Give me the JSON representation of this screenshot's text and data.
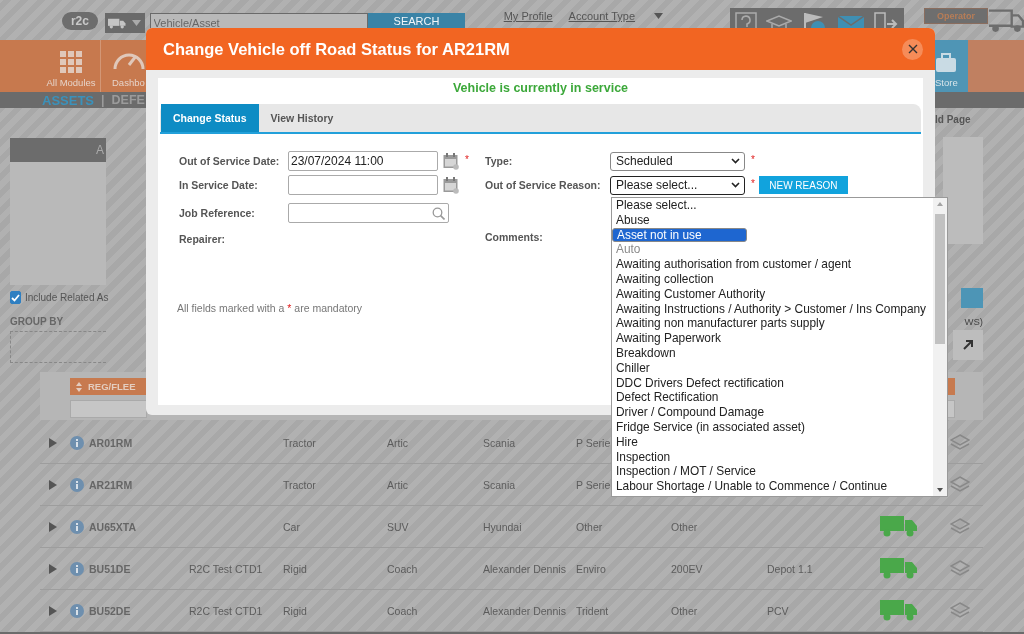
{
  "topbar": {
    "logo": "r2c",
    "search": {
      "placeholder": "Vehicle/Asset"
    },
    "search_button": "SEARCH",
    "links": [
      "My Profile",
      "Account Type"
    ],
    "operator_button": "Operator"
  },
  "nav": {
    "tiles": [
      {
        "label": "All Modules",
        "kind": "grid"
      },
      {
        "label": "Dashbo",
        "kind": "gauge"
      }
    ],
    "store": {
      "label": "Store"
    }
  },
  "breadcrumb": {
    "current": "ASSETS",
    "separator": "|",
    "next": "DEFE"
  },
  "page": {
    "panel_title": "A",
    "page_link": "ld Page",
    "include_related": {
      "label": "Include Related As",
      "checked": true
    },
    "group_by": "GROUP BY",
    "rows_note": "WS)",
    "sort_column": "REG/FLEE"
  },
  "table": {
    "rows": [
      {
        "cells": {
          "column_1": "AR01RM",
          "column_3": "Tractor",
          "column_4": "Artic",
          "column_5": "Scania",
          "column_6": "P Serie"
        },
        "vehicle_icon": false
      },
      {
        "cells": {
          "column_1": "AR21RM",
          "column_3": "Tractor",
          "column_4": "Artic",
          "column_5": "Scania",
          "column_6": "P Serie"
        },
        "vehicle_icon": false
      },
      {
        "cells": {
          "column_1": "AU65XTA",
          "column_3": "Car",
          "column_4": "SUV",
          "column_5": "Hyundai",
          "column_6": "Other",
          "column_7": "Other"
        },
        "vehicle_icon": true
      },
      {
        "cells": {
          "column_1": "BU51DE",
          "column_2": "R2C Test CTD1",
          "column_3": "Rigid",
          "column_4": "Coach",
          "column_5": "Alexander Dennis",
          "column_6": "Enviro",
          "column_7": "200EV",
          "column_8": "Depot 1.1"
        },
        "vehicle_icon": true
      },
      {
        "cells": {
          "column_1": "BU52DE",
          "column_2": "R2C Test CTD1",
          "column_3": "Rigid",
          "column_4": "Coach",
          "column_5": "Alexander Dennis",
          "column_6": "Trident",
          "column_7": "Other",
          "column_8": "PCV"
        },
        "vehicle_icon": true
      }
    ]
  },
  "dialog": {
    "title": "Change Vehicle off Road Status for AR21RM",
    "status_message": "Vehicle is currently in service",
    "tabs": [
      {
        "label": "Change Status",
        "selected": true
      },
      {
        "label": "View History",
        "selected": false
      }
    ],
    "required_mark": "*",
    "left_fields": [
      {
        "label": "Out of Service Date:",
        "kind": "date",
        "value": "23/07/2024 11:00",
        "required": true
      },
      {
        "label": "In Service Date:",
        "kind": "date",
        "required": false
      },
      {
        "label": "Job Reference:",
        "kind": "lookup",
        "required": false
      },
      {
        "label": "Repairer:",
        "kind": "label",
        "required": false
      }
    ],
    "right_fields": [
      {
        "label": "Type:",
        "kind": "select",
        "value": "Scheduled",
        "required": true,
        "expanded": false
      },
      {
        "label": "Out of Service Reason:",
        "kind": "select",
        "value": "Please select...",
        "required": true,
        "expanded": true,
        "button": "NEW REASON"
      },
      {
        "label": "Comments:",
        "kind": "label",
        "required": false
      }
    ],
    "note": {
      "before": "All fields marked with a",
      "mark": "*",
      "after": "are mandatory"
    },
    "reason_options": [
      {
        "label": "Please select...",
        "selected": false,
        "disabled": false
      },
      {
        "label": "Abuse",
        "selected": false,
        "disabled": false
      },
      {
        "label": "Asset not in use",
        "selected": true,
        "disabled": false
      },
      {
        "label": "Auto",
        "selected": false,
        "disabled": true
      },
      {
        "label": "Awaiting authorisation from customer / agent",
        "selected": false,
        "disabled": false
      },
      {
        "label": "Awaiting collection",
        "selected": false,
        "disabled": false
      },
      {
        "label": "Awaiting Customer Authority",
        "selected": false,
        "disabled": false
      },
      {
        "label": "Awaiting Instructions / Authority > Customer / Ins Company",
        "selected": false,
        "disabled": false
      },
      {
        "label": "Awaiting non manufacturer parts supply",
        "selected": false,
        "disabled": false
      },
      {
        "label": "Awaiting Paperwork",
        "selected": false,
        "disabled": false
      },
      {
        "label": "Breakdown",
        "selected": false,
        "disabled": false
      },
      {
        "label": "Chiller",
        "selected": false,
        "disabled": false
      },
      {
        "label": "DDC Drivers Defect rectification",
        "selected": false,
        "disabled": false
      },
      {
        "label": "Defect Rectification",
        "selected": false,
        "disabled": false
      },
      {
        "label": "Driver / Compound Damage",
        "selected": false,
        "disabled": false
      },
      {
        "label": "Fridge Service (in associated asset)",
        "selected": false,
        "disabled": false
      },
      {
        "label": "Hire",
        "selected": false,
        "disabled": false
      },
      {
        "label": "Inspection",
        "selected": false,
        "disabled": false
      },
      {
        "label": "Inspection / MOT / Service",
        "selected": false,
        "disabled": false
      },
      {
        "label": "Labour Shortage / Unable to Commence / Continue",
        "selected": false,
        "disabled": false
      }
    ]
  }
}
